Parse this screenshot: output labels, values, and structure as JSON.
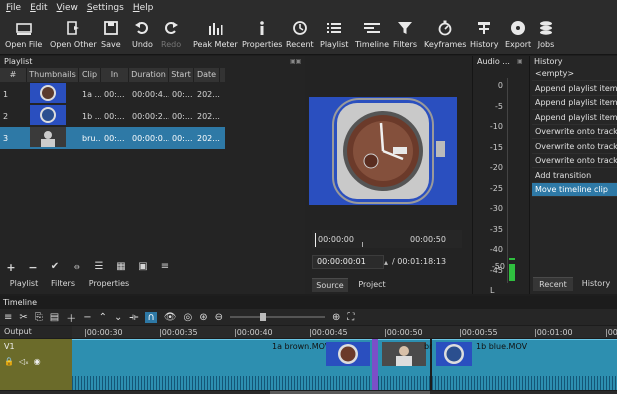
{
  "menu": [
    "File",
    "Edit",
    "View",
    "Settings",
    "Help"
  ],
  "toolbar": [
    {
      "label": "Open File",
      "icon": "open-file-icon"
    },
    {
      "label": "Open Other",
      "icon": "open-other-icon"
    },
    {
      "label": "Save",
      "icon": "save-icon"
    },
    {
      "label": "Undo",
      "icon": "undo-icon"
    },
    {
      "label": "Redo",
      "icon": "redo-icon"
    },
    {
      "label": "Peak Meter",
      "icon": "peak-meter-icon"
    },
    {
      "label": "Properties",
      "icon": "properties-icon"
    },
    {
      "label": "Recent",
      "icon": "recent-icon"
    },
    {
      "label": "Playlist",
      "icon": "playlist-icon"
    },
    {
      "label": "Timeline",
      "icon": "timeline-icon"
    },
    {
      "label": "Filters",
      "icon": "filters-icon"
    },
    {
      "label": "Keyframes",
      "icon": "keyframes-icon"
    },
    {
      "label": "History",
      "icon": "history-icon"
    },
    {
      "label": "Export",
      "icon": "export-icon"
    },
    {
      "label": "Jobs",
      "icon": "jobs-icon"
    }
  ],
  "playlist": {
    "title": "Playlist",
    "columns": [
      "#",
      "Thumbnails",
      "Clip",
      "In",
      "Duration",
      "Start",
      "Date"
    ],
    "rows": [
      {
        "num": "1",
        "clip": "1a ...",
        "in": "00:...",
        "duration": "00:00:4...",
        "start": "00:...",
        "date": "202..."
      },
      {
        "num": "2",
        "clip": "1b ...",
        "in": "00:...",
        "duration": "00:00:2...",
        "start": "00:...",
        "date": "202..."
      },
      {
        "num": "3",
        "clip": "bru...",
        "in": "00:...",
        "duration": "00:00:0...",
        "start": "00:...",
        "date": "202..."
      }
    ],
    "tabs": [
      "Playlist",
      "Filters",
      "Properties"
    ]
  },
  "player": {
    "time_left": "00:00:00",
    "time_right": "00:00:50",
    "position": "00:00:00:01",
    "duration": "/ 00:01:18:13",
    "tabs": [
      "Source",
      "Project"
    ]
  },
  "audio": {
    "title": "Audio ...",
    "scale": [
      "0",
      "-5",
      "-10",
      "-15",
      "-20",
      "-25",
      "-30",
      "-35",
      "-40",
      "-45",
      "-50"
    ],
    "channel": "L"
  },
  "history": {
    "title": "History",
    "items": [
      "<empty>",
      "Append playlist item",
      "Append playlist item",
      "Append playlist item",
      "Overwrite onto track",
      "Overwrite onto track",
      "Overwrite onto track",
      "Add transition",
      "Move timeline clip"
    ],
    "selected_index": 8,
    "tabs": [
      "Recent",
      "History"
    ]
  },
  "timeline": {
    "title": "Timeline",
    "output_label": "Output",
    "track_label": "V1",
    "ruler": [
      "|00:00:30",
      "|00:00:35",
      "|00:00:40",
      "|00:00:45",
      "|00:00:50",
      "|00:00:55",
      "|00:01:00",
      "|00:"
    ],
    "clips": [
      "1a brown.MOV",
      "br",
      "1b blue.MOV"
    ]
  },
  "colors": {
    "accent": "#2e79a6",
    "clip": "#2d8fb0",
    "meter": "#2fbf3f",
    "player_bg": "#2a4fbf"
  }
}
